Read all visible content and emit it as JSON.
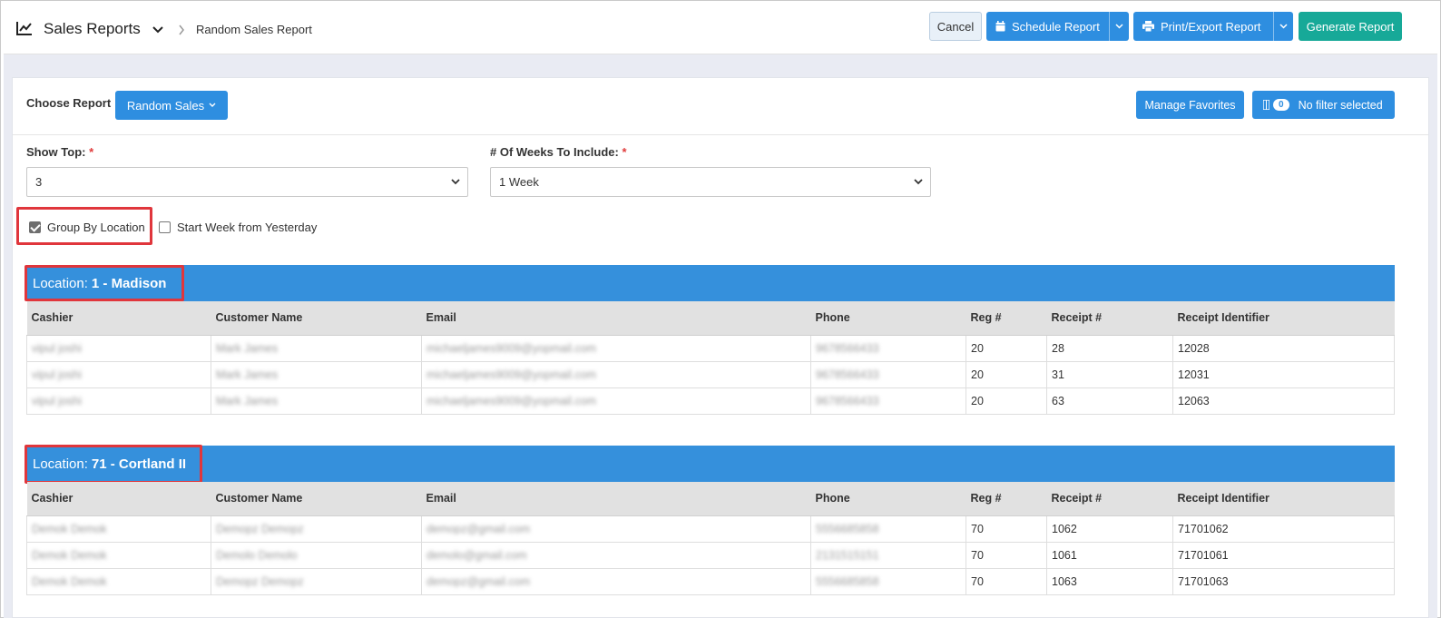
{
  "header": {
    "title": "Sales Reports",
    "breadcrumb": "Random Sales Report",
    "cancel_label": "Cancel",
    "schedule_label": "Schedule Report",
    "print_label": "Print/Export Report",
    "generate_label": "Generate Report"
  },
  "report_bar": {
    "choose_label": "Choose Report",
    "selected_report": "Random Sales",
    "favorites_label": "Manage Favorites",
    "filter_count": "0",
    "filter_label": "No filter selected"
  },
  "filters": {
    "show_top_label": "Show Top:",
    "show_top_value": "3",
    "weeks_label": "# Of Weeks To Include:",
    "weeks_value": "1 Week",
    "required_mark": "*",
    "group_by_location_label": "Group By Location",
    "group_by_location_checked": true,
    "start_week_label": "Start Week from Yesterday",
    "start_week_checked": false
  },
  "columns": [
    "Cashier",
    "Customer Name",
    "Email",
    "Phone",
    "Reg #",
    "Receipt #",
    "Receipt Identifier"
  ],
  "groups": [
    {
      "location_prefix": "Location:",
      "location_name": "1 - Madison",
      "rows": [
        [
          "vipul joshi",
          "Mark James",
          "michaeljames9009@yopmail.com",
          "9678566433",
          "20",
          "28",
          "12028"
        ],
        [
          "vipul joshi",
          "Mark James",
          "michaeljames9009@yopmail.com",
          "9678566433",
          "20",
          "31",
          "12031"
        ],
        [
          "vipul joshi",
          "Mark James",
          "michaeljames9009@yopmail.com",
          "9678566433",
          "20",
          "63",
          "12063"
        ]
      ]
    },
    {
      "location_prefix": "Location:",
      "location_name": "71 - Cortland II",
      "rows": [
        [
          "Demok Demok",
          "Demopz Demopz",
          "demopz@gmail.com",
          "5556685858",
          "70",
          "1062",
          "71701062"
        ],
        [
          "Demok Demok",
          "Demolo Demolo",
          "demolo@gmail.com",
          "2131515151",
          "70",
          "1061",
          "71701061"
        ],
        [
          "Demok Demok",
          "Demopz Demopz",
          "demopz@gmail.com",
          "5556685858",
          "70",
          "1063",
          "71701063"
        ]
      ]
    }
  ],
  "colors": {
    "primary": "#2e8ee0",
    "location_bar": "#3590dc",
    "generate": "#17a998",
    "highlight": "#e0363c"
  }
}
